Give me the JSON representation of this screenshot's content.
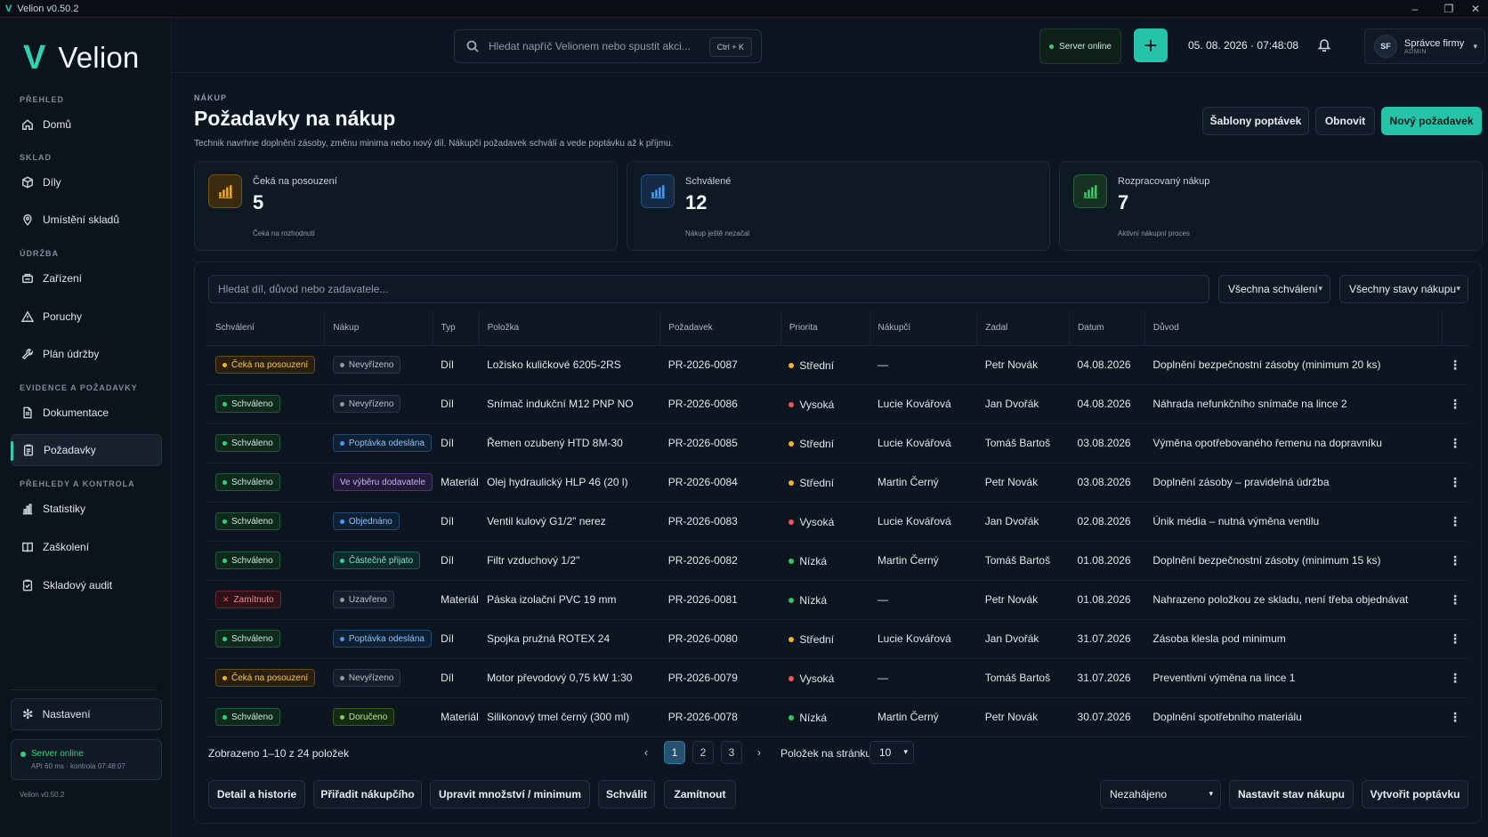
{
  "window": {
    "title": "Velion v0.50.2",
    "logo": "V",
    "minimize": "–",
    "maximize": "❐",
    "close": "✕"
  },
  "sidebar": {
    "brand": "Velion",
    "brand_mark": "V",
    "sections": {
      "prehled": "PŘEHLED",
      "sklad": "SKLAD",
      "udrzba": "ÚDRŽBA",
      "evidence": "EVIDENCE A POŽADAVKY",
      "kontrola": "PŘEHLEDY A KONTROLA"
    },
    "items": [
      {
        "label": "Domů",
        "icon": "home-icon"
      },
      {
        "label": "Díly",
        "icon": "box-icon"
      },
      {
        "label": "Umístění skladů",
        "icon": "location-pin-icon"
      },
      {
        "label": "Zařízení",
        "icon": "equipment-icon"
      },
      {
        "label": "Poruchy",
        "icon": "warning-icon"
      },
      {
        "label": "Plán údržby",
        "icon": "wrench-icon"
      },
      {
        "label": "Dokumentace",
        "icon": "document-icon"
      },
      {
        "label": "Požadavky",
        "icon": "clipboard-icon",
        "active": true
      },
      {
        "label": "Statistiky",
        "icon": "bar-chart-icon"
      },
      {
        "label": "Zaškolení",
        "icon": "book-icon"
      },
      {
        "label": "Skladový audit",
        "icon": "audit-icon"
      }
    ],
    "settings": "Nastavení",
    "server_status": "Server online",
    "server_detail": "API 60 ms · kontrola 07:48:07",
    "version": "Velion v0.50.2"
  },
  "topbar": {
    "search_placeholder": "Hledat napříč Velionem nebo spustit akci...",
    "shortcut": "Ctrl + K",
    "server_status": "Server online",
    "add": "+",
    "datetime": "05. 08. 2026 · 07:48:08",
    "user_initials": "SF",
    "user_name": "Správce firmy",
    "user_role": "ADMIN"
  },
  "page": {
    "breadcrumb": "NÁKUP",
    "title": "Požadavky na nákup",
    "subtitle": "Technik navrhne doplnění zásoby, změnu minima nebo nový díl. Nákupčí požadavek schválí a vede poptávku až k příjmu.",
    "btn_templates": "Šablony poptávek",
    "btn_refresh": "Obnovit",
    "btn_new": "Nový požadavek"
  },
  "cards": [
    {
      "label": "Čeká na posouzení",
      "value": "5",
      "sub": "Čeká na rozhodnutí",
      "color": "#f0a92a",
      "bg": "#3a2a10"
    },
    {
      "label": "Schválené",
      "value": "12",
      "sub": "Nákup ještě nezačal",
      "color": "#4a9df0",
      "bg": "#142a45"
    },
    {
      "label": "Rozpracovaný nákup",
      "value": "7",
      "sub": "Aktivní nákupní proces",
      "color": "#4cc46a",
      "bg": "#163222"
    }
  ],
  "filters": {
    "search_placeholder": "Hledat díl, důvod nebo zadavatele...",
    "approval": "Všechna schválení",
    "purchase": "Všechny stavy nákupu"
  },
  "table": {
    "columns": [
      "Schválení",
      "Nákup",
      "Typ",
      "Položka",
      "Požadavek",
      "Priorita",
      "Nákupčí",
      "Zadal",
      "Datum",
      "Důvod"
    ],
    "rows": [
      {
        "approval": "Čeká na posouzení",
        "a_cls": "wait",
        "purchase": "Nevyřízeno",
        "p_cls": "gray",
        "type": "Díl",
        "item": "Ložisko kuličkové 6205-2RS",
        "req": "PR-2026-0087",
        "priority": "Střední",
        "buyer": "—",
        "by": "Petr Novák",
        "date": "04.08.2026",
        "reason": "Doplnění bezpečnostní zásoby (minimum 20 ks)"
      },
      {
        "approval": "Schváleno",
        "a_cls": "ok",
        "purchase": "Nevyřízeno",
        "p_cls": "gray",
        "type": "Díl",
        "item": "Snímač indukční M12 PNP NO",
        "req": "PR-2026-0086",
        "priority": "Vysoká",
        "buyer": "Lucie Kovářová",
        "by": "Jan Dvořák",
        "date": "04.08.2026",
        "reason": "Náhrada nefunkčního snímače na lince 2"
      },
      {
        "approval": "Schváleno",
        "a_cls": "ok",
        "purchase": "Poptávka odeslána",
        "p_cls": "blue",
        "type": "Díl",
        "item": "Řemen ozubený HTD 8M-30",
        "req": "PR-2026-0085",
        "priority": "Střední",
        "buyer": "Lucie Kovářová",
        "by": "Tomáš Bartoš",
        "date": "03.08.2026",
        "reason": "Výměna opotřebovaného řemenu na dopravníku"
      },
      {
        "approval": "Schváleno",
        "a_cls": "ok",
        "purchase": "Ve výběru dodavatele",
        "p_cls": "purple",
        "type": "Materiál",
        "item": "Olej hydraulický HLP 46 (20 l)",
        "req": "PR-2026-0084",
        "priority": "Střední",
        "buyer": "Martin Černý",
        "by": "Petr Novák",
        "date": "03.08.2026",
        "reason": "Doplnění zásoby – pravidelná údržba"
      },
      {
        "approval": "Schváleno",
        "a_cls": "ok",
        "purchase": "Objednáno",
        "p_cls": "blue",
        "type": "Díl",
        "item": "Ventil kulový G1/2\" nerez",
        "req": "PR-2026-0083",
        "priority": "Vysoká",
        "buyer": "Lucie Kovářová",
        "by": "Jan Dvořák",
        "date": "02.08.2026",
        "reason": "Únik média – nutná výměna ventilu"
      },
      {
        "approval": "Schváleno",
        "a_cls": "ok",
        "purchase": "Částečně přijato",
        "p_cls": "teal",
        "type": "Díl",
        "item": "Filtr vzduchový 1/2\"",
        "req": "PR-2026-0082",
        "priority": "Nízká",
        "buyer": "Martin Černý",
        "by": "Tomáš Bartoš",
        "date": "01.08.2026",
        "reason": "Doplnění bezpečnostní zásoby (minimum 15 ks)"
      },
      {
        "approval": "Zamítnuto",
        "a_cls": "rej",
        "purchase": "Uzavřeno",
        "p_cls": "gray",
        "type": "Materiál",
        "item": "Páska izolační PVC 19 mm",
        "req": "PR-2026-0081",
        "priority": "Nízká",
        "buyer": "—",
        "by": "Petr Novák",
        "date": "01.08.2026",
        "reason": "Nahrazeno položkou ze skladu, není třeba objednávat"
      },
      {
        "approval": "Schváleno",
        "a_cls": "ok",
        "purchase": "Poptávka odeslána",
        "p_cls": "blue",
        "type": "Díl",
        "item": "Spojka pružná ROTEX 24",
        "req": "PR-2026-0080",
        "priority": "Střední",
        "buyer": "Lucie Kovářová",
        "by": "Jan Dvořák",
        "date": "31.07.2026",
        "reason": "Zásoba klesla pod minimum"
      },
      {
        "approval": "Čeká na posouzení",
        "a_cls": "wait",
        "purchase": "Nevyřízeno",
        "p_cls": "gray",
        "type": "Díl",
        "item": "Motor převodový 0,75 kW 1:30",
        "req": "PR-2026-0079",
        "priority": "Vysoká",
        "buyer": "—",
        "by": "Tomáš Bartoš",
        "date": "31.07.2026",
        "reason": "Preventivní výměna na lince 1"
      },
      {
        "approval": "Schváleno",
        "a_cls": "ok",
        "purchase": "Doručeno",
        "p_cls": "green",
        "type": "Materiál",
        "item": "Silikonový tmel černý (300 ml)",
        "req": "PR-2026-0078",
        "priority": "Nízká",
        "buyer": "Martin Černý",
        "by": "Petr Novák",
        "date": "30.07.2026",
        "reason": "Doplnění spotřebního materiálu"
      }
    ]
  },
  "colors": {
    "accent": "#25c3a8",
    "priority_high": "#f0505c",
    "priority_mid": "#f0b429",
    "priority_low": "#33c46a",
    "online": "#33d17a"
  },
  "pagination": {
    "shown": "Zobrazeno 1–10 z 24 položek",
    "prev": "‹",
    "next": "›",
    "pages": [
      "1",
      "2",
      "3"
    ],
    "per_page_label": "Položek na stránku",
    "per_page": "10"
  },
  "actions": {
    "detail": "Detail a historie",
    "assign": "Přiřadit nákupčího",
    "edit_qty": "Upravit množství / minimum",
    "approve": "Schválit",
    "reject": "Zamítnout",
    "status_select": "Nezahájeno",
    "set_status": "Nastavit stav nákupu",
    "create_inquiry": "Vytvořit poptávku"
  }
}
